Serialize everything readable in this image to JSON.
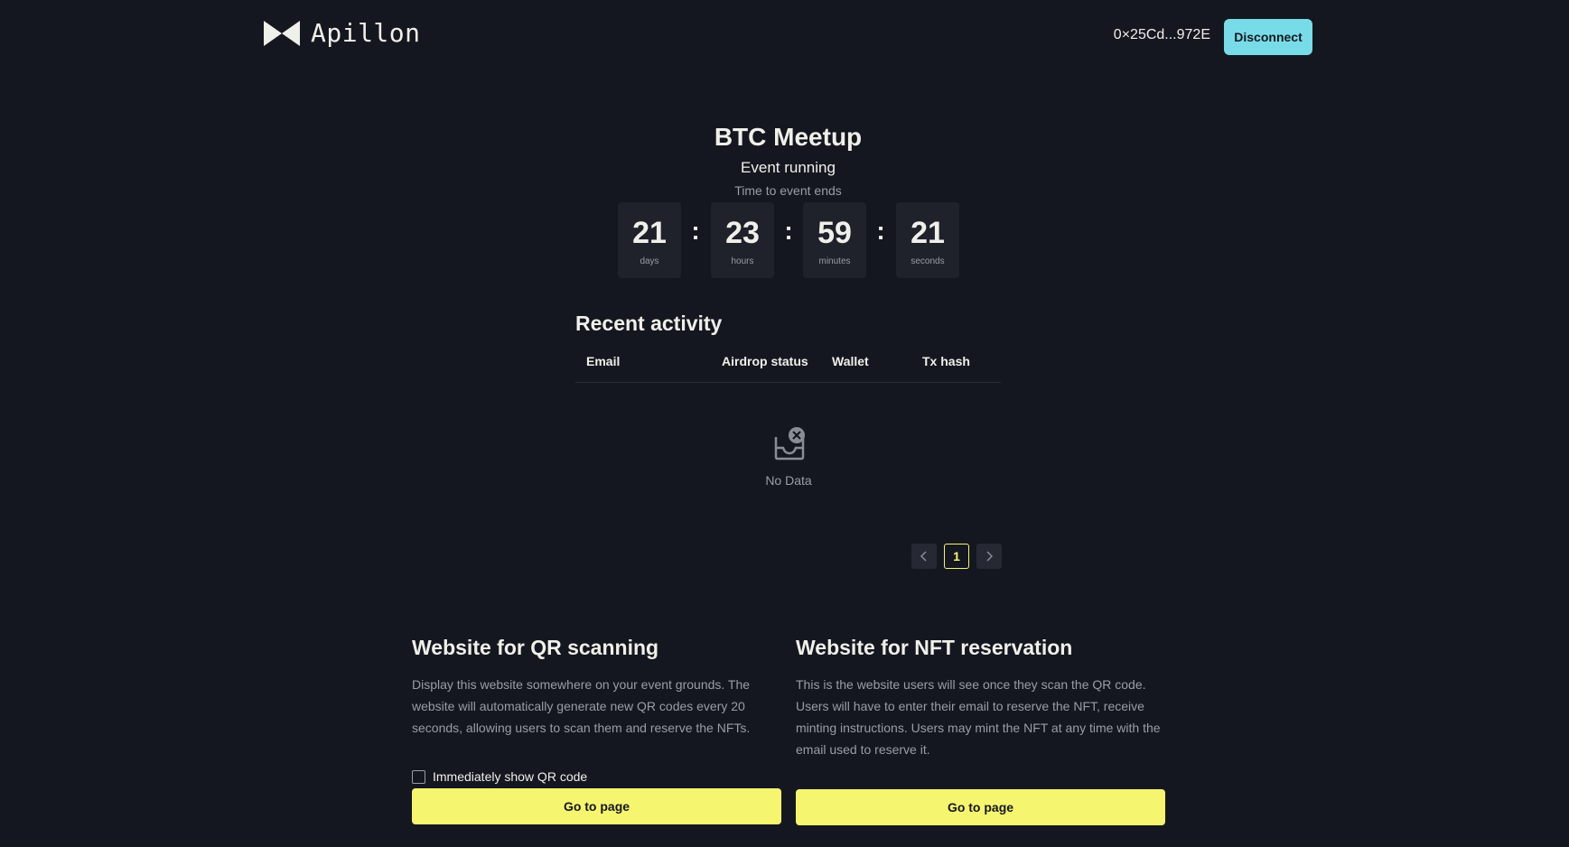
{
  "header": {
    "logo_text": "Apillon",
    "wallet_address": "0×25Cd...972E",
    "disconnect_label": "Disconnect"
  },
  "event": {
    "title": "BTC Meetup",
    "status": "Event running",
    "countdown_label": "Time to event ends",
    "countdown": [
      {
        "value": "21",
        "unit": "days"
      },
      {
        "value": "23",
        "unit": "hours"
      },
      {
        "value": "59",
        "unit": "minutes"
      },
      {
        "value": "21",
        "unit": "seconds"
      }
    ],
    "separator": ":"
  },
  "activity": {
    "title": "Recent activity",
    "columns": [
      "Email",
      "Airdrop status",
      "Wallet",
      "Tx hash"
    ],
    "empty_text": "No Data",
    "pagination": {
      "current": "1",
      "prev_icon": "chevron-left-icon",
      "next_icon": "chevron-right-icon"
    }
  },
  "cards": [
    {
      "title": "Website for QR scanning",
      "description": "Display this website somewhere on your event grounds. The website will automatically generate new QR codes every 20 seconds, allowing users to scan them and reserve the NFTs.",
      "checkbox_label": "Immediately show QR code",
      "button_label": "Go to page"
    },
    {
      "title": "Website for NFT reservation",
      "description": "This is the website users will see once they scan the QR code. Users will have to enter their email to reserve the NFT, receive minting instructions. Users may mint the NFT at any time with the email used to reserve it.",
      "button_label": "Go to page"
    }
  ],
  "colors": {
    "background": "#151720",
    "accent_cyan": "#78dce8",
    "accent_yellow": "#f5f570",
    "muted_text": "#9a9ca6"
  }
}
